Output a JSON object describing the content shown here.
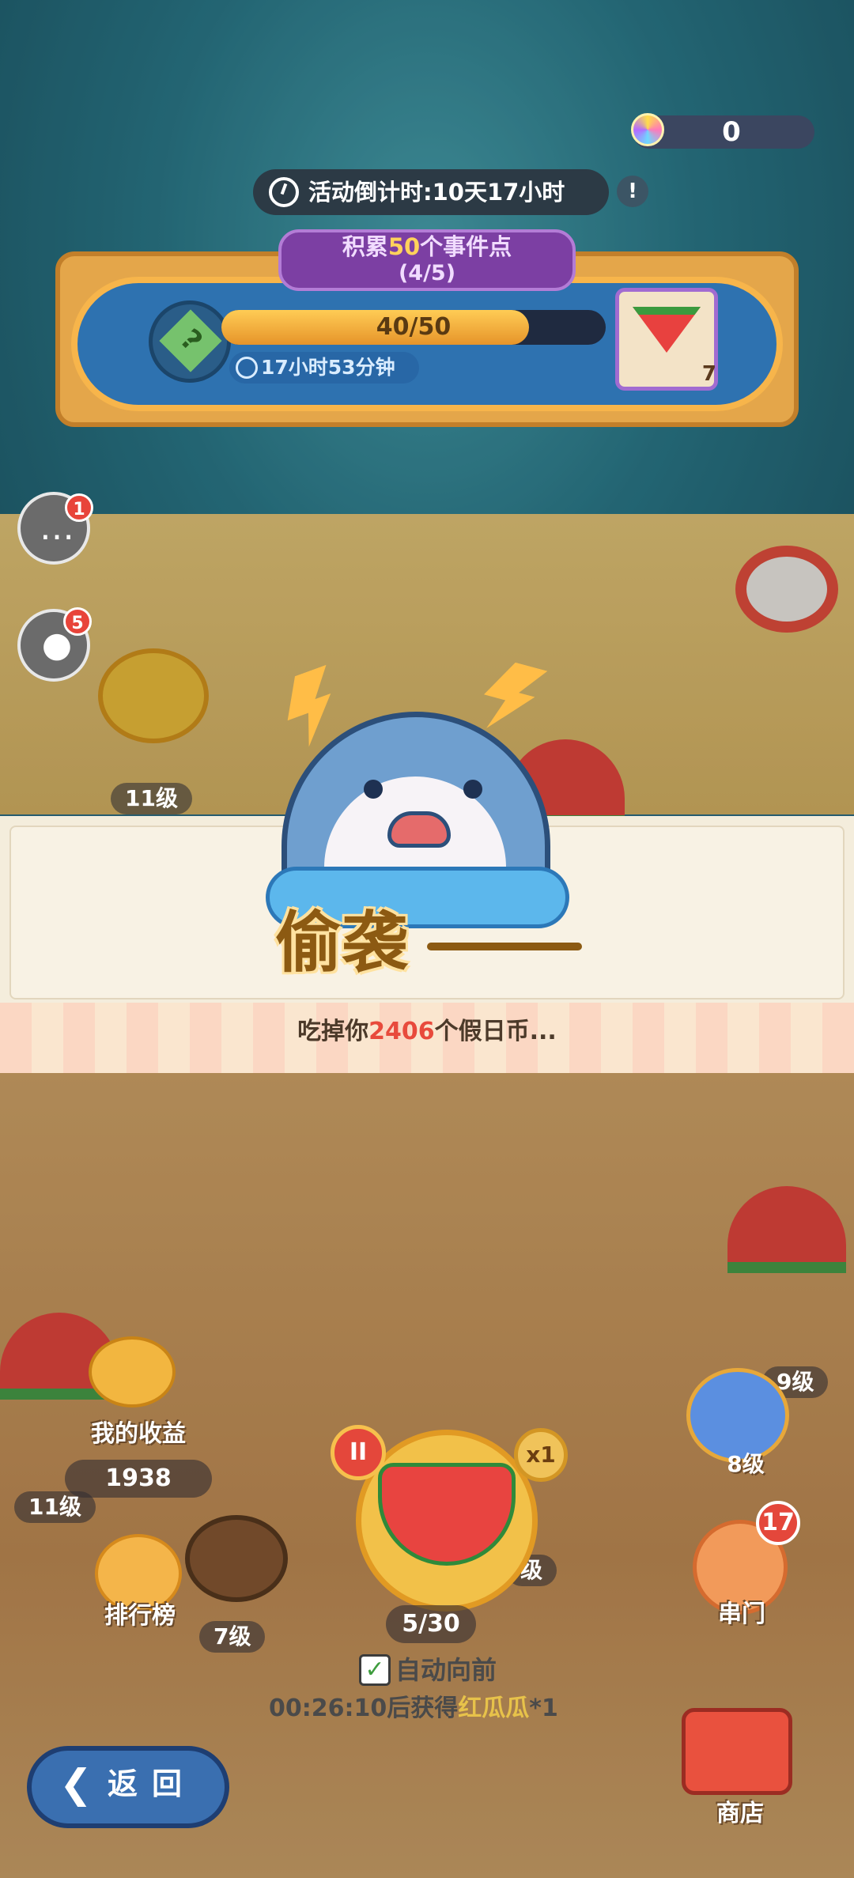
{
  "hud": {
    "coin_value": "0",
    "countdown": "活动倒计时:10天17小时",
    "info_glyph": "!"
  },
  "event": {
    "title_prefix": "积累",
    "title_highlight": "50",
    "title_suffix": "个事件点",
    "progress": "(4/5)",
    "bar_text": "40/50",
    "bar_fraction": 0.8,
    "timer": "17小时53分钟",
    "reward_count": "7",
    "reward_icon": "watermelon-icon"
  },
  "side": {
    "chat_badge": "1",
    "pet_badge": "5",
    "chat_icon": "chat-bubble-icon",
    "pet_icon": "cow-face-icon"
  },
  "board_levels": {
    "top_left": "11级",
    "right_9": "9级",
    "ring_8": "8级",
    "left_11": "11级",
    "coconut_7": "7级",
    "center_partial": "级"
  },
  "banner": {
    "title": "偷袭",
    "msg_prefix": "吃掉你",
    "msg_number": "2406",
    "msg_suffix": "个假日币..."
  },
  "bottom": {
    "income_label": "我的收益",
    "income_value": "1938",
    "rank_label": "排行榜",
    "pause_glyph": "II",
    "multiplier": "x1",
    "dice_count": "5/30",
    "auto_label": "自动向前",
    "auto_check": "✓",
    "reward_prefix": "00:26:10后获得",
    "reward_item": "红瓜瓜",
    "reward_suffix": "*1",
    "ring_label": "8级",
    "door_badge": "17",
    "door_label": "串门",
    "back_label": "返回",
    "back_arrow": "❮",
    "shop_label": "商店"
  },
  "colors": {
    "accent_red": "#e84a3c",
    "purple_tag": "#7c3fa3",
    "gold": "#ffd25b"
  }
}
